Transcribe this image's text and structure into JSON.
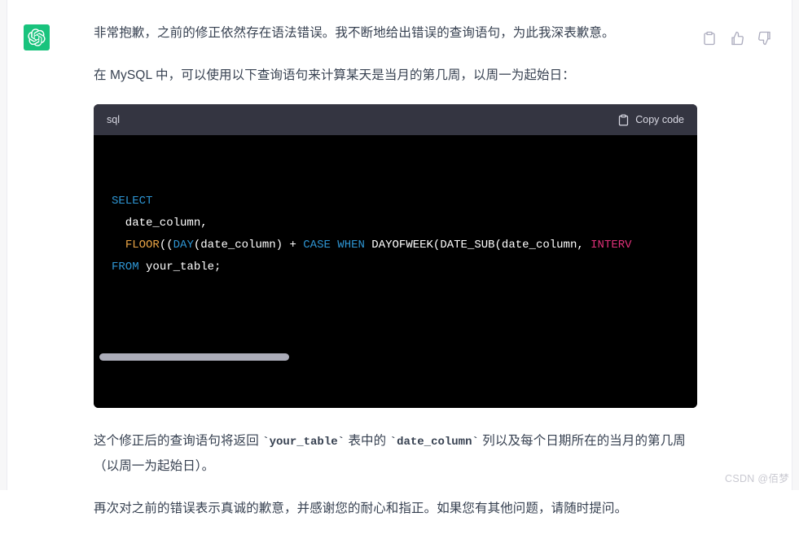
{
  "message": {
    "avatar_icon": "openai-logo-icon",
    "avatar_color": "#19c37d",
    "paragraphs": {
      "intro": "非常抱歉，之前的修正依然存在语法错误。我不断地给出错误的查询语句，为此我深表歉意。",
      "lead_in": "在 MySQL 中，可以使用以下查询语句来计算某天是当月的第几周，以周一为起始日：",
      "explain_prefix": "这个修正后的查询语句将返回 ",
      "explain_code_1": "`your_table`",
      "explain_mid": " 表中的 ",
      "explain_code_2": "`date_column`",
      "explain_suffix": " 列以及每个日期所在的当月的第几周（以周一为起始日）。",
      "closing": "再次对之前的错误表示真诚的歉意，并感谢您的耐心和指正。如果您有其他问题，请随时提问。"
    }
  },
  "code_block": {
    "language": "sql",
    "copy_label": "Copy code",
    "copy_icon": "clipboard-icon",
    "lines": {
      "l1_kw": "SELECT",
      "l2_text": "  date_column,",
      "l3_indent": "  ",
      "l3_fn": "FLOOR",
      "l3_p1": "((",
      "l3_day": "DAY",
      "l3_p2": "(date_column) + ",
      "l3_case": "CASE WHEN",
      "l3_p3": " DAYOFWEEK(DATE_SUB(date_column, ",
      "l3_interval": "INTERV",
      "l4_kw": "FROM",
      "l4_text": " your_table;"
    },
    "scrollbar_visible": true
  },
  "actions": [
    {
      "name": "copy-message-icon",
      "label": "Copy"
    },
    {
      "name": "thumbs-up-icon",
      "label": "Good response"
    },
    {
      "name": "thumbs-down-icon",
      "label": "Bad response"
    }
  ],
  "watermark": {
    "text": "CSDN @佰梦"
  },
  "colors": {
    "accent_green": "#19c37d",
    "code_header_bg": "#343541",
    "code_body_bg": "#000000",
    "keyword_blue": "#2e95d3",
    "function_orange": "#e9a445",
    "interval_pink": "#df3079",
    "body_text": "#374151"
  }
}
